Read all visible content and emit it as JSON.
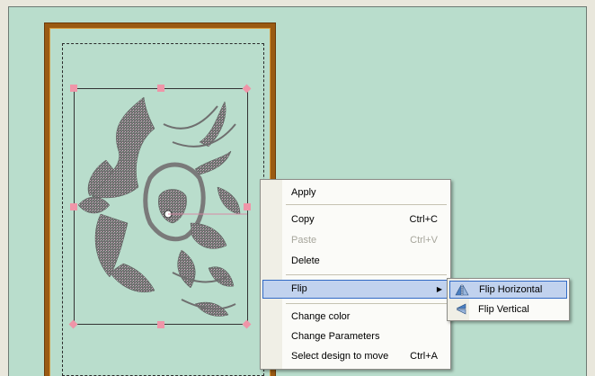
{
  "context_menu": {
    "items": [
      {
        "label": "Apply",
        "shortcut": "",
        "enabled": true
      },
      {
        "label": "Copy",
        "shortcut": "Ctrl+C",
        "enabled": true
      },
      {
        "label": "Paste",
        "shortcut": "Ctrl+V",
        "enabled": false
      },
      {
        "label": "Delete",
        "shortcut": "",
        "enabled": true
      },
      {
        "label": "Flip",
        "shortcut": "",
        "enabled": true,
        "has_submenu": true
      },
      {
        "label": "Change color",
        "shortcut": "",
        "enabled": true
      },
      {
        "label": "Change Parameters",
        "shortcut": "",
        "enabled": true
      },
      {
        "label": "Select design to move",
        "shortcut": "Ctrl+A",
        "enabled": true
      }
    ]
  },
  "flip_submenu": {
    "items": [
      {
        "label": "Flip Horizontal",
        "icon": "flip-horizontal-icon"
      },
      {
        "label": "Flip Vertical",
        "icon": "flip-vertical-icon"
      }
    ]
  },
  "colors": {
    "canvas": "#b9ddcc",
    "hoop": "#9a5a12",
    "handle": "#ef95a8",
    "highlight": "#c1d2ee",
    "highlight_border": "#316ac5"
  }
}
